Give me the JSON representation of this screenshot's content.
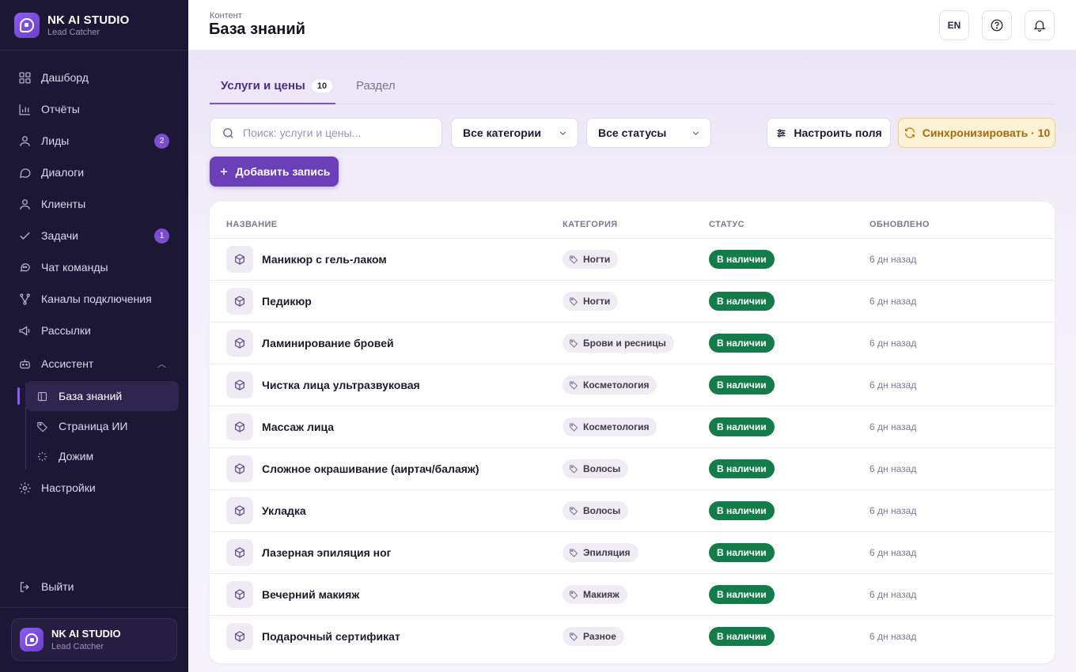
{
  "brand": {
    "title": "NK AI STUDIO",
    "subtitle": "Lead Catcher"
  },
  "nav": {
    "dashboard": "Дашборд",
    "reports": "Отчёты",
    "leads": "Лиды",
    "leads_badge": "2",
    "dialogs": "Диалоги",
    "clients": "Клиенты",
    "tasks": "Задачи",
    "tasks_badge": "1",
    "team_chat": "Чат команды",
    "channels": "Каналы подключения",
    "mailings": "Рассылки",
    "assistant": "Ассистент",
    "assistant_sub": [
      "База знаний",
      "Страница ИИ",
      "Дожим"
    ],
    "settings": "Настройки",
    "logout": "Выйти"
  },
  "account": {
    "title": "NK AI STUDIO",
    "subtitle": "Lead Catcher"
  },
  "header": {
    "breadcrumb": "Контент",
    "title": "База знаний",
    "lang": "EN"
  },
  "tabs": [
    {
      "label": "Услуги и цены",
      "count": "10"
    },
    {
      "label": "Раздел"
    }
  ],
  "toolbar": {
    "search_placeholder": "Поиск: услуги и цены...",
    "category_filter": "Все категории",
    "status_filter": "Все статусы",
    "configure_fields": "Настроить поля",
    "sync": "Синхронизировать · 10",
    "add_record": "Добавить запись"
  },
  "table": {
    "columns": [
      "НАЗВАНИЕ",
      "КАТЕГОРИЯ",
      "СТАТУС",
      "ОБНОВЛЕНО"
    ],
    "rows": [
      {
        "name": "Маникюр с гель-лаком",
        "category": "Ногти",
        "status": "В наличии",
        "updated": "6 дн назад"
      },
      {
        "name": "Педикюр",
        "category": "Ногти",
        "status": "В наличии",
        "updated": "6 дн назад"
      },
      {
        "name": "Ламинирование бровей",
        "category": "Брови и ресницы",
        "status": "В наличии",
        "updated": "6 дн назад"
      },
      {
        "name": "Чистка лица ультразвуковая",
        "category": "Косметология",
        "status": "В наличии",
        "updated": "6 дн назад"
      },
      {
        "name": "Массаж лица",
        "category": "Косметология",
        "status": "В наличии",
        "updated": "6 дн назад"
      },
      {
        "name": "Сложное окрашивание (аиртач/балаяж)",
        "category": "Волосы",
        "status": "В наличии",
        "updated": "6 дн назад"
      },
      {
        "name": "Укладка",
        "category": "Волосы",
        "status": "В наличии",
        "updated": "6 дн назад"
      },
      {
        "name": "Лазерная эпиляция ног",
        "category": "Эпиляция",
        "status": "В наличии",
        "updated": "6 дн назад"
      },
      {
        "name": "Вечерний макияж",
        "category": "Макияж",
        "status": "В наличии",
        "updated": "6 дн назад"
      },
      {
        "name": "Подарочный сертификат",
        "category": "Разное",
        "status": "В наличии",
        "updated": "6 дн назад"
      }
    ]
  },
  "colors": {
    "sidebar": "#1d1736",
    "accent": "#6b3fb8",
    "status_green": "#137c4a",
    "sync_bg": "#fdf1d6"
  }
}
